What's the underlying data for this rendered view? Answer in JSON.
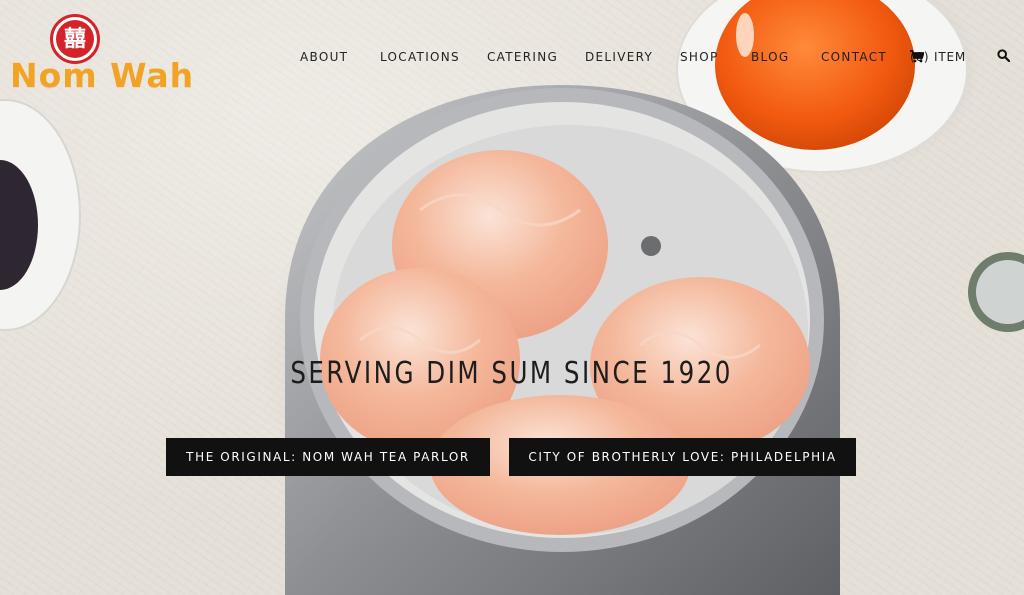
{
  "brand": {
    "name": "Nom Wah",
    "logo_glyph": "囍",
    "logo_color": "#d3242b",
    "wordmark_color": "#f2a324"
  },
  "nav": {
    "about": "ABOUT",
    "locations": "LOCATIONS",
    "catering": "CATERING",
    "delivery": "DELIVERY",
    "shop": "SHOP",
    "blog": "BLOG",
    "contact": "CONTACT",
    "cart_label": "(0) ITEM",
    "cart_icon": "shopping-cart-icon",
    "search_icon": "search-icon"
  },
  "hero": {
    "tagline": "SERVING DIM SUM SINCE 1920",
    "buttons": [
      {
        "label": "THE ORIGINAL: NOM WAH TEA PARLOR"
      },
      {
        "label": "CITY OF BROTHERLY LOVE: PHILADELPHIA"
      }
    ],
    "button_color": "#111111"
  }
}
